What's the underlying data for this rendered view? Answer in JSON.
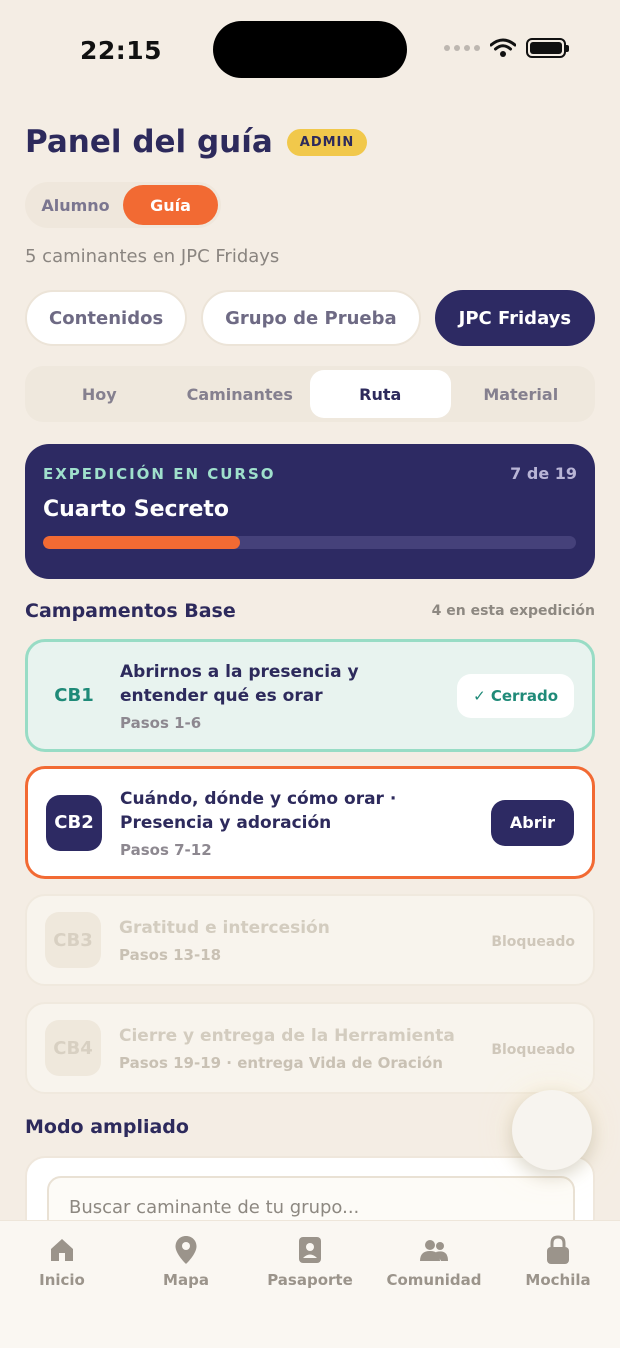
{
  "status": {
    "time": "22:15"
  },
  "header": {
    "title": "Panel del guía",
    "badge": "ADMIN"
  },
  "role_toggle": {
    "options": [
      "Alumno",
      "Guía"
    ],
    "selected": "Guía"
  },
  "subtitle": "5 caminantes en JPC Fridays",
  "groups": {
    "items": [
      "Contenidos",
      "Grupo de Prueba",
      "JPC Fridays"
    ],
    "selected": "JPC Fridays"
  },
  "tabs": {
    "items": [
      "Hoy",
      "Caminantes",
      "Ruta",
      "Material"
    ],
    "selected": "Ruta"
  },
  "expedition": {
    "label": "EXPEDICIÓN EN CURSO",
    "count": "7 de 19",
    "name": "Cuarto Secreto",
    "progress": 0.37,
    "accent": "#f26a33"
  },
  "camps_section": {
    "title": "Campamentos Base",
    "meta": "4 en esta expedición"
  },
  "camps": [
    {
      "code": "CB1",
      "title": "Abrirnos a la presencia y entender qué es orar",
      "steps": "Pasos 1-6",
      "status": "closed",
      "action": "✓ Cerrado"
    },
    {
      "code": "CB2",
      "title": "Cuándo, dónde y cómo orar · Presencia y adoración",
      "steps": "Pasos 7-12",
      "status": "open",
      "action": "Abrir"
    },
    {
      "code": "CB3",
      "title": "Gratitud e intercesión",
      "steps": "Pasos 13-18",
      "status": "locked",
      "action": "Bloqueado"
    },
    {
      "code": "CB4",
      "title": "Cierre y entrega de la Herramienta",
      "steps": "Pasos 19-19 · entrega Vida de Oración",
      "status": "locked",
      "action": "Bloqueado"
    }
  ],
  "expanded_mode": {
    "title": "Modo ampliado",
    "search_placeholder": "Buscar caminante de tu grupo..."
  },
  "bottom_nav": [
    {
      "label": "Inicio",
      "icon": "home-icon"
    },
    {
      "label": "Mapa",
      "icon": "map-pin-icon"
    },
    {
      "label": "Pasaporte",
      "icon": "passport-icon"
    },
    {
      "label": "Comunidad",
      "icon": "community-icon"
    },
    {
      "label": "Mochila",
      "icon": "lock-icon"
    }
  ]
}
